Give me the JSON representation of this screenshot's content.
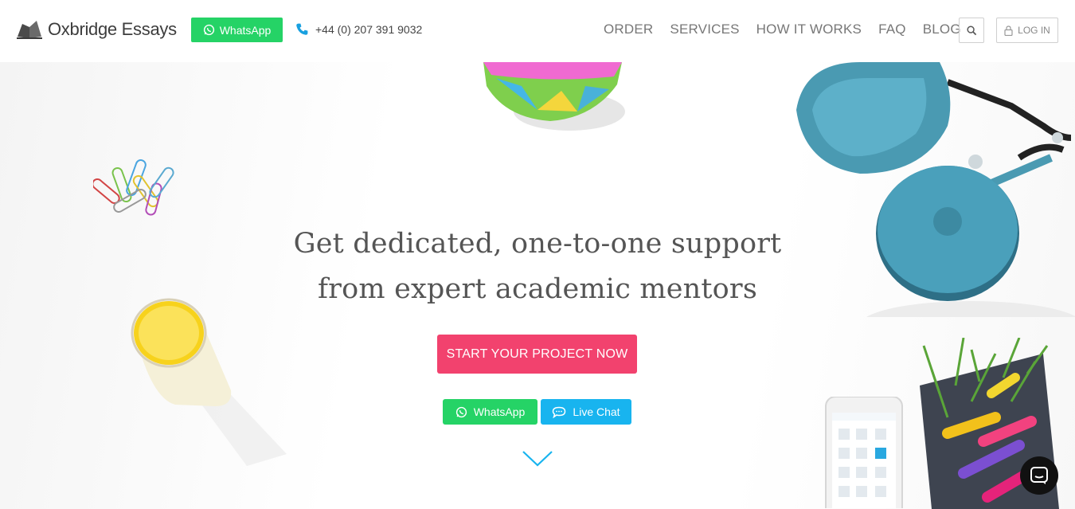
{
  "brand": {
    "name": "Oxbridge Essays"
  },
  "header": {
    "whatsapp_label": "WhatsApp",
    "phone": "+44 (0) 207 391 9032",
    "nav": [
      "ORDER",
      "SERVICES",
      "HOW IT WORKS",
      "FAQ",
      "BLOG"
    ],
    "login_label": "LOG IN"
  },
  "hero": {
    "title_line1": "Get dedicated, one-to-one support",
    "title_line2": "from expert academic mentors",
    "cta_label": "START YOUR PROJECT NOW",
    "whatsapp_label": "WhatsApp",
    "livechat_label": "Live Chat"
  },
  "colors": {
    "whatsapp": "#25d366",
    "cta": "#f2426e",
    "livechat": "#18b4ef",
    "accent_chevron": "#18b4ef"
  },
  "icons": [
    "whatsapp-icon",
    "phone-icon",
    "search-icon",
    "lock-icon",
    "chat-bubble-icon",
    "chevron-down-icon",
    "intercom-chat-icon"
  ]
}
